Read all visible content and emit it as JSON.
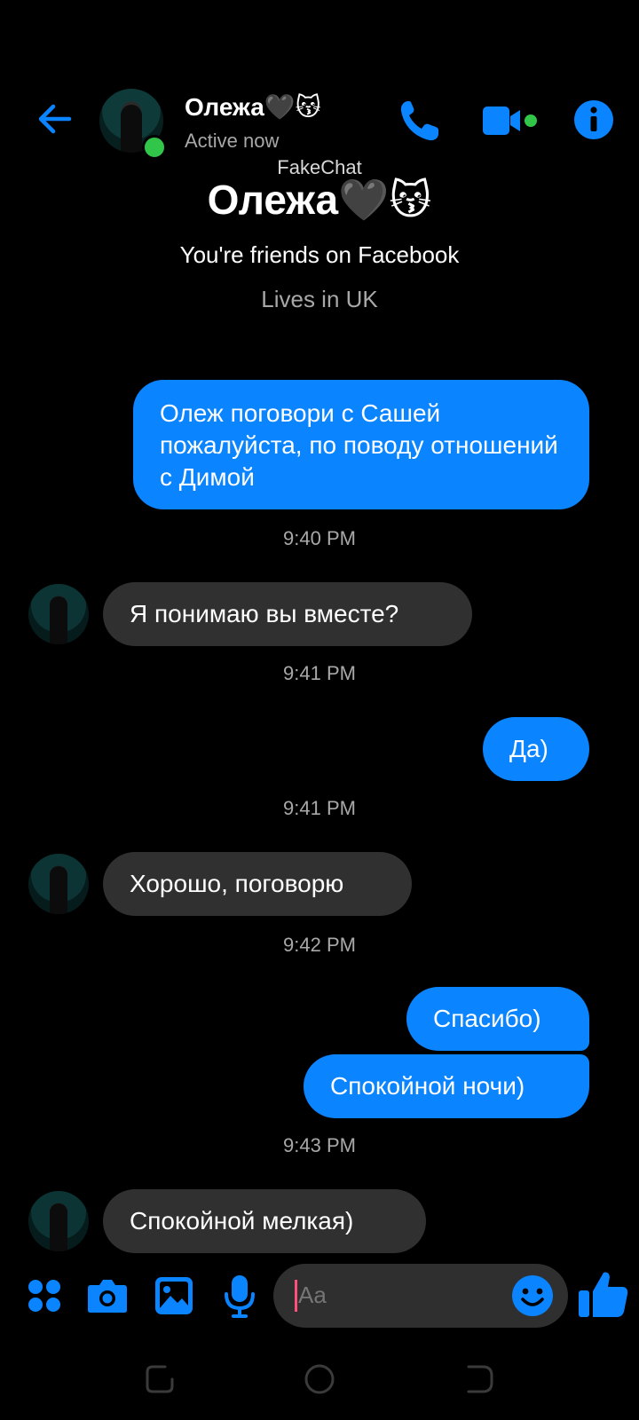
{
  "header": {
    "contact_name": "Олежа🖤😽",
    "status": "Active now",
    "watermark": "FakeChat"
  },
  "profile": {
    "name": "Олежа🖤😽",
    "friends_line": "You're friends on Facebook",
    "lives_line": "Lives in UK"
  },
  "messages": [
    {
      "text": "Олеж поговори с Сашей пожалуйста, по поводу отношений с Димой",
      "dir": "out"
    },
    {
      "time": "9:40 PM"
    },
    {
      "text": "Я понимаю вы вместе?",
      "dir": "in"
    },
    {
      "time": "9:41 PM"
    },
    {
      "text": "Да)",
      "dir": "out"
    },
    {
      "time": "9:41 PM"
    },
    {
      "text": "Хорошо, поговорю",
      "dir": "in"
    },
    {
      "time": "9:42 PM"
    },
    {
      "text": "Спасибо)",
      "dir": "out"
    },
    {
      "text": "Спокойной ночи)",
      "dir": "out"
    },
    {
      "time": "9:43 PM"
    },
    {
      "text": "Спокойной мелкая)",
      "dir": "in"
    }
  ],
  "composer": {
    "placeholder": "Aa"
  },
  "colors": {
    "accent": "#0a84ff",
    "online": "#31c549",
    "incoming_bubble": "#303030",
    "background": "#000000"
  },
  "icons": [
    "back-arrow-icon",
    "phone-icon",
    "video-camera-icon",
    "info-icon",
    "apps-grid-icon",
    "camera-icon",
    "image-icon",
    "microphone-icon",
    "emoji-icon",
    "thumbs-up-icon"
  ]
}
